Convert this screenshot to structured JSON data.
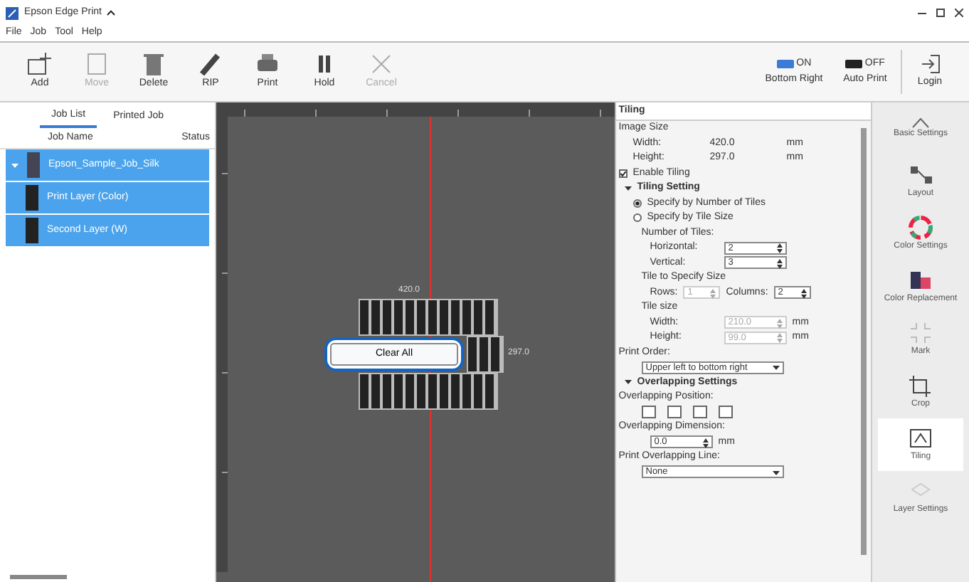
{
  "window": {
    "title": "Epson Edge Print"
  },
  "menu": [
    "File",
    "Job",
    "Tool",
    "Help"
  ],
  "toolbar": [
    {
      "label": "Add",
      "disabled": false
    },
    {
      "label": "Move",
      "disabled": true
    },
    {
      "label": "Delete",
      "disabled": false
    },
    {
      "label": "RIP",
      "disabled": false
    },
    {
      "label": "Print",
      "disabled": false
    },
    {
      "label": "Hold",
      "disabled": false
    },
    {
      "label": "Cancel",
      "disabled": true
    }
  ],
  "toggles": [
    {
      "state": "ON",
      "label": "Bottom Right",
      "on": true
    },
    {
      "state": "OFF",
      "label": "Auto Print",
      "on": false
    }
  ],
  "login": {
    "label": "Login"
  },
  "job_panel": {
    "tabs": [
      {
        "label": "Job List",
        "selected": true
      },
      {
        "label": "Printed Job",
        "selected": false
      }
    ],
    "columns": [
      "Job Name",
      "Status"
    ],
    "jobs": [
      {
        "name": "Epson_Sample_Job_Silk",
        "selected": true,
        "expanded": true,
        "children": [
          {
            "name": "Print Layer (Color)",
            "selected": true
          },
          {
            "name": "Second Layer (W)",
            "selected": true
          }
        ]
      }
    ]
  },
  "canvas": {
    "width_label": "420.0",
    "height_label": "297.0",
    "button": "Clear All"
  },
  "tiling": {
    "title": "Tiling",
    "rows": [
      {
        "kind": "label",
        "text": "Image Size"
      },
      {
        "kind": "info",
        "label": "Width:",
        "value": "420.0",
        "unit": "mm"
      },
      {
        "kind": "info",
        "label": "Height:",
        "value": "297.0",
        "unit": "mm"
      },
      {
        "kind": "check",
        "text": "Enable Tiling",
        "checked": true
      },
      {
        "kind": "section",
        "text": "Tiling Setting",
        "expanded": true
      },
      {
        "kind": "radio",
        "text": "Specify by Number of Tiles",
        "selected": true
      },
      {
        "kind": "radio",
        "text": "Specify by Tile Size",
        "selected": false
      },
      {
        "kind": "sub",
        "text": "Number of Tiles:"
      },
      {
        "kind": "spin",
        "label": "Horizontal:",
        "value": "2",
        "unit": "",
        "disabled": false
      },
      {
        "kind": "spin",
        "label": "Vertical:",
        "value": "3",
        "unit": "",
        "disabled": false
      },
      {
        "kind": "sub",
        "text": "Tile to Specify Size"
      },
      {
        "kind": "pair",
        "fields": [
          {
            "label": "Rows:",
            "value": "1",
            "disabled": true
          },
          {
            "label": "Columns:",
            "value": "2",
            "disabled": false
          }
        ]
      },
      {
        "kind": "sub",
        "text": "Tile size"
      },
      {
        "kind": "spin",
        "label": "Width:",
        "value": "210.0",
        "unit": "mm",
        "disabled": true
      },
      {
        "kind": "spin",
        "label": "Height:",
        "value": "99.0",
        "unit": "mm",
        "disabled": true
      },
      {
        "kind": "label",
        "text": "Print Order:"
      },
      {
        "kind": "select",
        "value": "Upper left to bottom right"
      },
      {
        "kind": "section",
        "text": "Overlapping Settings",
        "expanded": true
      },
      {
        "kind": "label",
        "text": "Overlapping Position:"
      },
      {
        "kind": "icons"
      },
      {
        "kind": "label",
        "text": "Overlapping Dimension:"
      },
      {
        "kind": "spin",
        "label": "",
        "value": "0.0",
        "unit": "mm",
        "disabled": false
      },
      {
        "kind": "label",
        "text": "Print Overlapping Line:"
      },
      {
        "kind": "select",
        "value": "None"
      }
    ]
  },
  "side_menu": [
    {
      "label": "Basic Settings",
      "selected": false
    },
    {
      "label": "Layout",
      "selected": false
    },
    {
      "label": "Color Settings",
      "selected": false
    },
    {
      "label": "Color Replacement",
      "selected": false
    },
    {
      "label": "Mark",
      "selected": false
    },
    {
      "label": "Crop",
      "selected": false
    },
    {
      "label": "Tiling",
      "selected": true
    },
    {
      "label": "Layer Settings",
      "selected": false
    }
  ]
}
